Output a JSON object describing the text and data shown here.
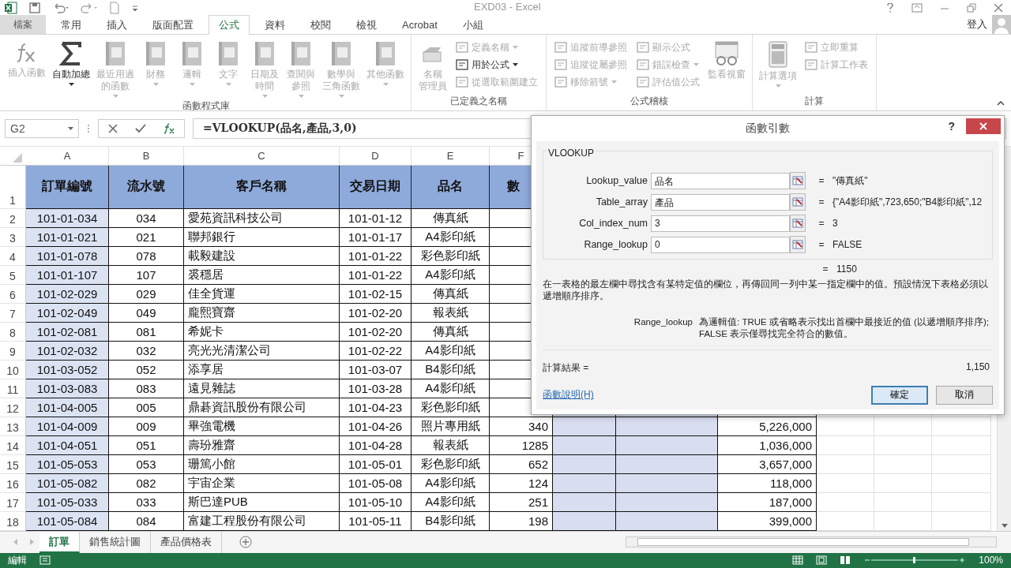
{
  "app": {
    "title": "EXD03 - Excel",
    "user": "登入"
  },
  "tabs": [
    {
      "label": "檔案",
      "selected": false,
      "kind": "file"
    },
    {
      "label": "常用",
      "selected": false,
      "kind": "tab"
    },
    {
      "label": "插入",
      "selected": false,
      "kind": "tab"
    },
    {
      "label": "版面配置",
      "selected": false,
      "kind": "tab"
    },
    {
      "label": "公式",
      "selected": true,
      "kind": "tab"
    },
    {
      "label": "資料",
      "selected": false,
      "kind": "tab"
    },
    {
      "label": "校閱",
      "selected": false,
      "kind": "tab"
    },
    {
      "label": "檢視",
      "selected": false,
      "kind": "tab"
    },
    {
      "label": "Acrobat",
      "selected": false,
      "kind": "tab"
    },
    {
      "label": "小組",
      "selected": false,
      "kind": "tab"
    }
  ],
  "ribbon": [
    {
      "label": "函數程式庫",
      "items": [
        {
          "kind": "large",
          "lines": [
            "插入函數"
          ],
          "disabled": true,
          "dropdown": false
        },
        {
          "kind": "large",
          "lines": [
            "自動加總"
          ],
          "disabled": false,
          "dropdown": true
        },
        {
          "kind": "large",
          "lines": [
            "最近用過",
            "的函數"
          ],
          "disabled": true,
          "dropdown": true
        },
        {
          "kind": "large",
          "lines": [
            "財務"
          ],
          "disabled": true,
          "dropdown": true
        },
        {
          "kind": "large",
          "lines": [
            "邏輯"
          ],
          "disabled": true,
          "dropdown": true
        },
        {
          "kind": "large",
          "lines": [
            "文字"
          ],
          "disabled": true,
          "dropdown": true
        },
        {
          "kind": "large",
          "lines": [
            "日期及",
            "時間"
          ],
          "disabled": true,
          "dropdown": true
        },
        {
          "kind": "large",
          "lines": [
            "查閱與",
            "參照"
          ],
          "disabled": true,
          "dropdown": true
        },
        {
          "kind": "large",
          "lines": [
            "數學與",
            "三角函數"
          ],
          "disabled": true,
          "dropdown": true
        },
        {
          "kind": "large",
          "lines": [
            "其他函數"
          ],
          "disabled": true,
          "dropdown": true
        }
      ]
    },
    {
      "label": "已定義之名稱",
      "items": [
        {
          "kind": "large",
          "lines": [
            "名稱",
            "管理員"
          ],
          "disabled": true,
          "dropdown": false
        },
        {
          "kind": "stack",
          "items": [
            {
              "label": "定義名稱",
              "disabled": true,
              "dropdown": true
            },
            {
              "label": "用於公式",
              "disabled": false,
              "dropdown": true
            },
            {
              "label": "從選取範圍建立",
              "disabled": true,
              "dropdown": false
            }
          ]
        }
      ]
    },
    {
      "label": "公式稽核",
      "items": [
        {
          "kind": "stack",
          "items": [
            {
              "label": "追蹤前導參照",
              "disabled": true,
              "dropdown": false
            },
            {
              "label": "追蹤從屬參照",
              "disabled": true,
              "dropdown": false
            },
            {
              "label": "移除箭號",
              "disabled": true,
              "dropdown": true
            }
          ]
        },
        {
          "kind": "stack",
          "items": [
            {
              "label": "顯示公式",
              "disabled": true,
              "dropdown": false
            },
            {
              "label": "錯誤檢查",
              "disabled": true,
              "dropdown": true
            },
            {
              "label": "評估值公式",
              "disabled": true,
              "dropdown": false
            }
          ]
        },
        {
          "kind": "large",
          "lines": [
            "監看視窗"
          ],
          "disabled": true,
          "dropdown": false
        }
      ]
    },
    {
      "label": "計算",
      "items": [
        {
          "kind": "large",
          "lines": [
            "計算選項"
          ],
          "disabled": true,
          "dropdown": true
        },
        {
          "kind": "stack",
          "items": [
            {
              "label": "立即重算",
              "disabled": true,
              "dropdown": false
            },
            {
              "label": "計算工作表",
              "disabled": true,
              "dropdown": false
            }
          ]
        }
      ]
    }
  ],
  "formula_bar": {
    "name_box": "G2",
    "formula": "=VLOOKUP(品名,產品,3,0)"
  },
  "columns": [
    "A",
    "B",
    "C",
    "D",
    "E",
    "F"
  ],
  "headers": [
    "訂單編號",
    "流水號",
    "客戶名稱",
    "交易日期",
    "品名",
    "數"
  ],
  "rows": [
    {
      "row": "1"
    },
    {
      "row": "2",
      "cells": [
        "101-01-034",
        "034",
        "愛苑資訊科技公司",
        "101-01-12",
        "傳真紙"
      ]
    },
    {
      "row": "3",
      "cells": [
        "101-01-021",
        "021",
        "聯邦銀行",
        "101-01-17",
        "A4影印紙"
      ]
    },
    {
      "row": "4",
      "cells": [
        "101-01-078",
        "078",
        "載毅建設",
        "101-01-22",
        "彩色影印紙"
      ]
    },
    {
      "row": "5",
      "cells": [
        "101-01-107",
        "107",
        "裘穩居",
        "101-01-22",
        "A4影印紙"
      ]
    },
    {
      "row": "6",
      "cells": [
        "101-02-029",
        "029",
        "佳全貨運",
        "101-02-15",
        "傳真紙"
      ]
    },
    {
      "row": "7",
      "cells": [
        "101-02-049",
        "049",
        "龐熙寶齋",
        "101-02-20",
        "報表紙"
      ]
    },
    {
      "row": "8",
      "cells": [
        "101-02-081",
        "081",
        "希妮卡",
        "101-02-20",
        "傳真紙"
      ]
    },
    {
      "row": "9",
      "cells": [
        "101-02-032",
        "032",
        "亮光光清潔公司",
        "101-02-22",
        "A4影印紙"
      ]
    },
    {
      "row": "10",
      "cells": [
        "101-03-052",
        "052",
        "添享居",
        "101-03-07",
        "B4影印紙"
      ]
    },
    {
      "row": "11",
      "cells": [
        "101-03-083",
        "083",
        "遠見雜誌",
        "101-03-28",
        "A4影印紙"
      ]
    },
    {
      "row": "12",
      "cells": [
        "101-04-005",
        "005",
        "鼎碁資訊股份有限公司",
        "101-04-23",
        "彩色影印紙"
      ]
    },
    {
      "row": "13",
      "cells": [
        "101-04-009",
        "009",
        "畢強電機",
        "101-04-26",
        "照片專用紙",
        "340"
      ],
      "column_i": "5,226,000"
    },
    {
      "row": "14",
      "cells": [
        "101-04-051",
        "051",
        "壽玢雅齋",
        "101-04-28",
        "報表紙",
        "1285"
      ],
      "column_i": "1,036,000"
    },
    {
      "row": "15",
      "cells": [
        "101-05-053",
        "053",
        "珊篤小館",
        "101-05-01",
        "彩色影印紙",
        "652"
      ],
      "column_i": "3,657,000"
    },
    {
      "row": "16",
      "cells": [
        "101-05-082",
        "082",
        "宇宙企業",
        "101-05-08",
        "A4影印紙",
        "124"
      ],
      "column_i": "118,000"
    },
    {
      "row": "17",
      "cells": [
        "101-05-033",
        "033",
        "斯巴達PUB",
        "101-05-10",
        "A4影印紙",
        "251"
      ],
      "column_i": "187,000"
    },
    {
      "row": "18",
      "cells": [
        "101-05-084",
        "084",
        "富建工程股份有限公司",
        "101-05-11",
        "B4影印紙",
        "198"
      ],
      "column_i": "399,000"
    }
  ],
  "dialog": {
    "title": "函數引數",
    "help": "?",
    "function": "VLOOKUP",
    "args": [
      {
        "name": "Lookup_value",
        "value": "品名",
        "equals": "=",
        "result": "\"傳真紙\""
      },
      {
        "name": "Table_array",
        "value": "產品",
        "equals": "=",
        "result": "{\"A4影印紙\",723,650;\"B4影印紙\",12"
      },
      {
        "name": "Col_index_num",
        "value": "3",
        "equals": "=",
        "result": "3"
      },
      {
        "name": "Range_lookup",
        "value": "0",
        "equals": "=",
        "result": "FALSE"
      }
    ],
    "equals": "=",
    "formula_result": "1150",
    "description": "在一表格的最左欄中尋找含有某特定值的欄位，再傳回同一列中某一指定欄中的值。預設情況下表格必須以遞增順序排序。",
    "arg_help_name": "Range_lookup",
    "arg_help": "為邏輯值: TRUE 或省略表示找出首欄中最接近的值 (以遞增順序排序); FALSE 表示僅尋找完全符合的數值。",
    "result_label": "計算結果 =",
    "result_value": "1,150",
    "help_link": "函數說明(H)",
    "buttons": [
      {
        "label": "確定",
        "default": true
      },
      {
        "label": "取消",
        "default": false
      }
    ]
  },
  "sheets": [
    {
      "label": "訂單",
      "selected": true
    },
    {
      "label": "銷售統計圖",
      "selected": false
    },
    {
      "label": "產品價格表",
      "selected": false
    }
  ],
  "status": {
    "mode": "編輯",
    "zoom": "100%"
  }
}
